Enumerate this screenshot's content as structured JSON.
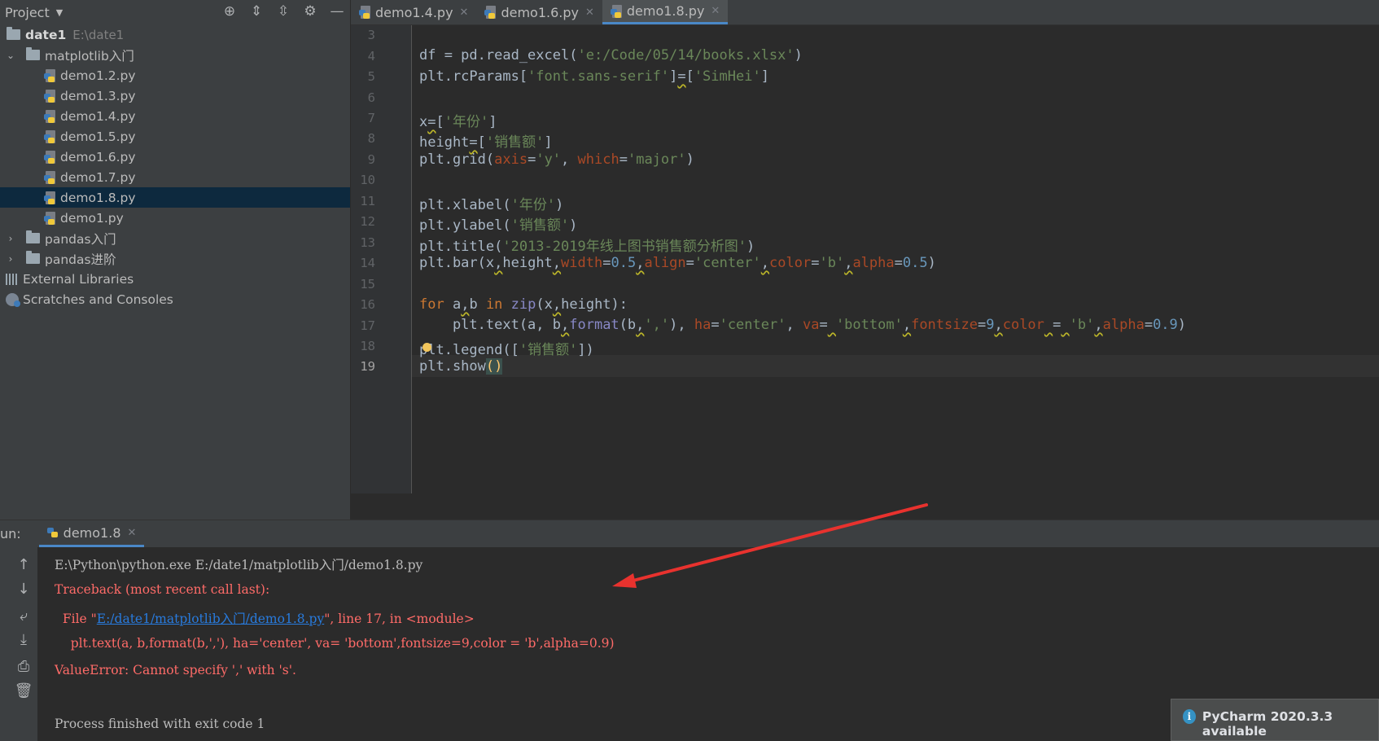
{
  "project": {
    "title": "Project",
    "tree": [
      {
        "label": "date1",
        "hint": "E:\\date1"
      },
      {
        "label": "matplotlib入门"
      },
      {
        "label": "demo1.2.py"
      },
      {
        "label": "demo1.3.py"
      },
      {
        "label": "demo1.4.py"
      },
      {
        "label": "demo1.5.py"
      },
      {
        "label": "demo1.6.py"
      },
      {
        "label": "demo1.7.py"
      },
      {
        "label": "demo1.8.py"
      },
      {
        "label": "demo1.py"
      },
      {
        "label": "pandas入门"
      },
      {
        "label": "pandas进阶"
      },
      {
        "label": "External Libraries"
      },
      {
        "label": "Scratches and Consoles"
      }
    ]
  },
  "tabs": [
    {
      "label": "demo1.4.py"
    },
    {
      "label": "demo1.6.py"
    },
    {
      "label": "demo1.8.py",
      "active": true
    }
  ],
  "editor": {
    "line_numbers": [
      "3",
      "4",
      "5",
      "6",
      "7",
      "8",
      "9",
      "10",
      "11",
      "12",
      "13",
      "14",
      "15",
      "16",
      "17",
      "18",
      "19"
    ],
    "current_line": "19"
  },
  "run": {
    "label": "un:",
    "tab": "demo1.8",
    "console": {
      "cmd": "E:\\Python\\python.exe E:/date1/matplotlib入门/demo1.8.py",
      "traceback": "Traceback (most recent call last):",
      "file_prefix": "  File \"",
      "file_link": "E:/date1/matplotlib入门/demo1.8.py",
      "file_suffix": "\", line 17, in <module>",
      "code": "    plt.text(a, b,format(b,','), ha='center', va= 'bottom',fontsize=9,color = 'b',alpha=0.9)",
      "error": "ValueError: Cannot specify ',' with 's'.",
      "exit": "Process finished with exit code 1"
    }
  },
  "notification": {
    "message": "PyCharm 2020.3.3 available"
  },
  "colors": {
    "accent": "#4a88c7",
    "error": "#ff6b68",
    "arrow": "#e8322e"
  }
}
